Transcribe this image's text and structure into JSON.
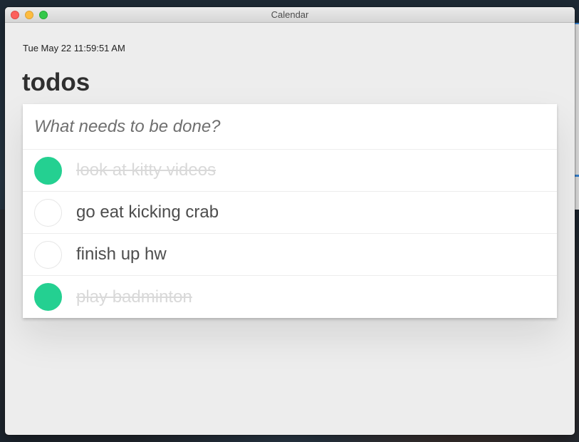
{
  "window": {
    "title": "Calendar"
  },
  "header": {
    "datetime": "Tue May 22 11:59:51 AM",
    "app_title": "todos"
  },
  "new_todo": {
    "placeholder": "What needs to be done?",
    "value": ""
  },
  "todos": [
    {
      "label": "look at kitty videos",
      "completed": true
    },
    {
      "label": "go eat kicking crab",
      "completed": false
    },
    {
      "label": "finish up hw",
      "completed": false
    },
    {
      "label": "play badminton",
      "completed": true
    }
  ],
  "colors": {
    "accent_complete": "#24d091",
    "window_bg": "#ededed",
    "completed_text": "#d9d9d9"
  }
}
